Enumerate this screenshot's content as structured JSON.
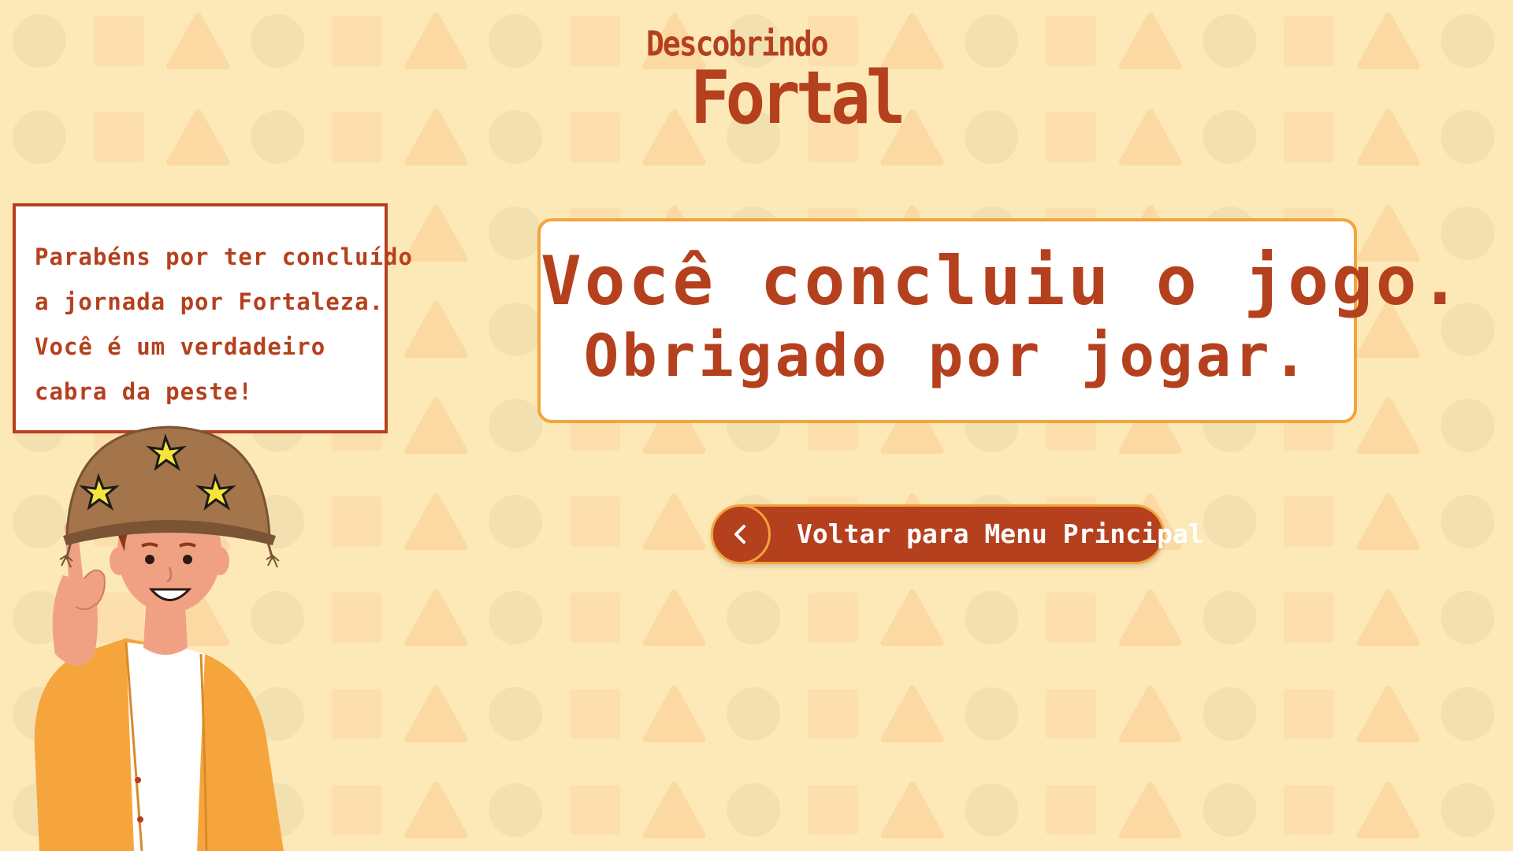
{
  "logo": {
    "top_text": "Descobrindo",
    "main_text": "Fortal"
  },
  "speech": {
    "lines": [
      "Parabéns por ter concluído",
      "a jornada por Fortaleza.",
      "Você é um verdadeiro",
      "cabra da peste!"
    ]
  },
  "message": {
    "line1": "Você concluiu o jogo.",
    "line2": "Obrigado por jogar."
  },
  "back_button": {
    "label": "Voltar para Menu Principal",
    "icon": "chevron-left-icon"
  },
  "character": {
    "icon": "cangaceiro-boy-character"
  },
  "colors": {
    "background": "#fde9b7",
    "primary": "#b5401e",
    "accent": "#f3a43c",
    "card": "#ffffff"
  }
}
